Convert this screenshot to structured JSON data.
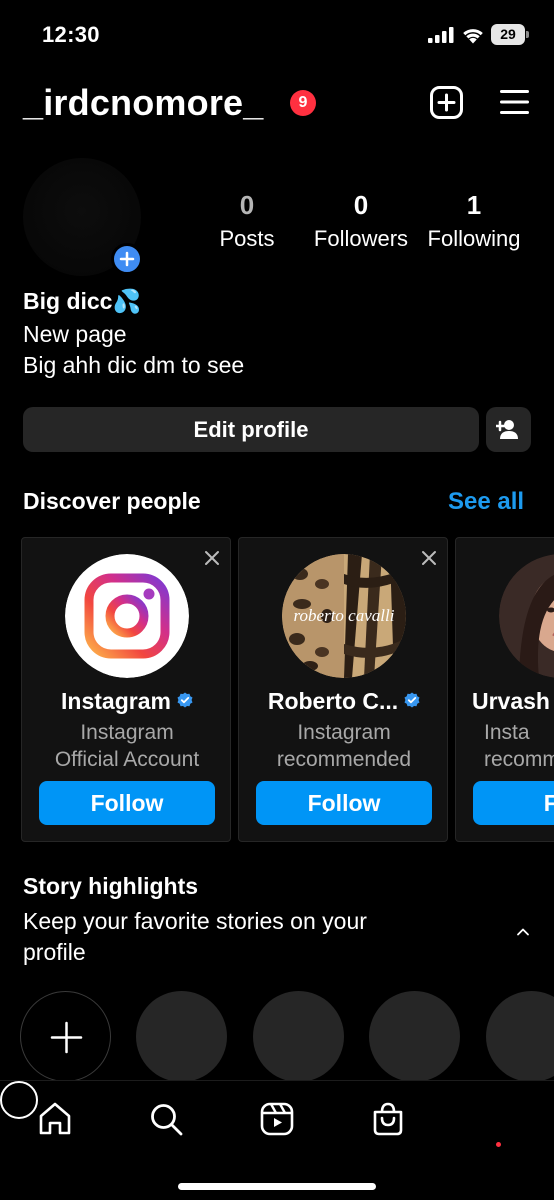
{
  "status_bar": {
    "time": "12:30",
    "battery_level": "29",
    "icons": [
      "signal-icon",
      "wifi-icon",
      "battery-icon"
    ]
  },
  "header": {
    "username": "_irdcnomore_",
    "notification_count": "9",
    "icons": [
      "create-post-icon",
      "menu-icon"
    ]
  },
  "profile": {
    "stats": {
      "posts_count": "0",
      "posts_label": "Posts",
      "followers_count": "0",
      "followers_label": "Followers",
      "following_count": "1",
      "following_label": "Following"
    },
    "bio": {
      "name": "Big dicc💦",
      "line1": "New page",
      "line2": "Big ahh dic dm to see"
    },
    "edit_profile_label": "Edit profile"
  },
  "discover": {
    "title": "Discover people",
    "see_all": "See all",
    "cards": [
      {
        "name": "Instagram",
        "verified": true,
        "sub1": "Instagram",
        "sub2": "Official Account",
        "follow": "Follow"
      },
      {
        "name": "Roberto C...",
        "verified": true,
        "sub1": "Instagram",
        "sub2": "recommended",
        "follow": "Follow",
        "avatar_text": "roberto cavalli"
      },
      {
        "name": "Urvash",
        "verified": false,
        "sub1": "Insta",
        "sub2": "recomm",
        "follow": "Fol"
      }
    ]
  },
  "highlights": {
    "title": "Story highlights",
    "subtitle": "Keep your favorite stories on your profile"
  },
  "bottom_nav": {
    "items": [
      "home-icon",
      "search-icon",
      "reels-icon",
      "shop-icon",
      "profile-icon"
    ]
  },
  "colors": {
    "accent_blue": "#0095f6",
    "link_blue": "#1d9bf0",
    "badge_red": "#ff3040",
    "card_bg": "#121212",
    "button_bg": "#262626"
  }
}
